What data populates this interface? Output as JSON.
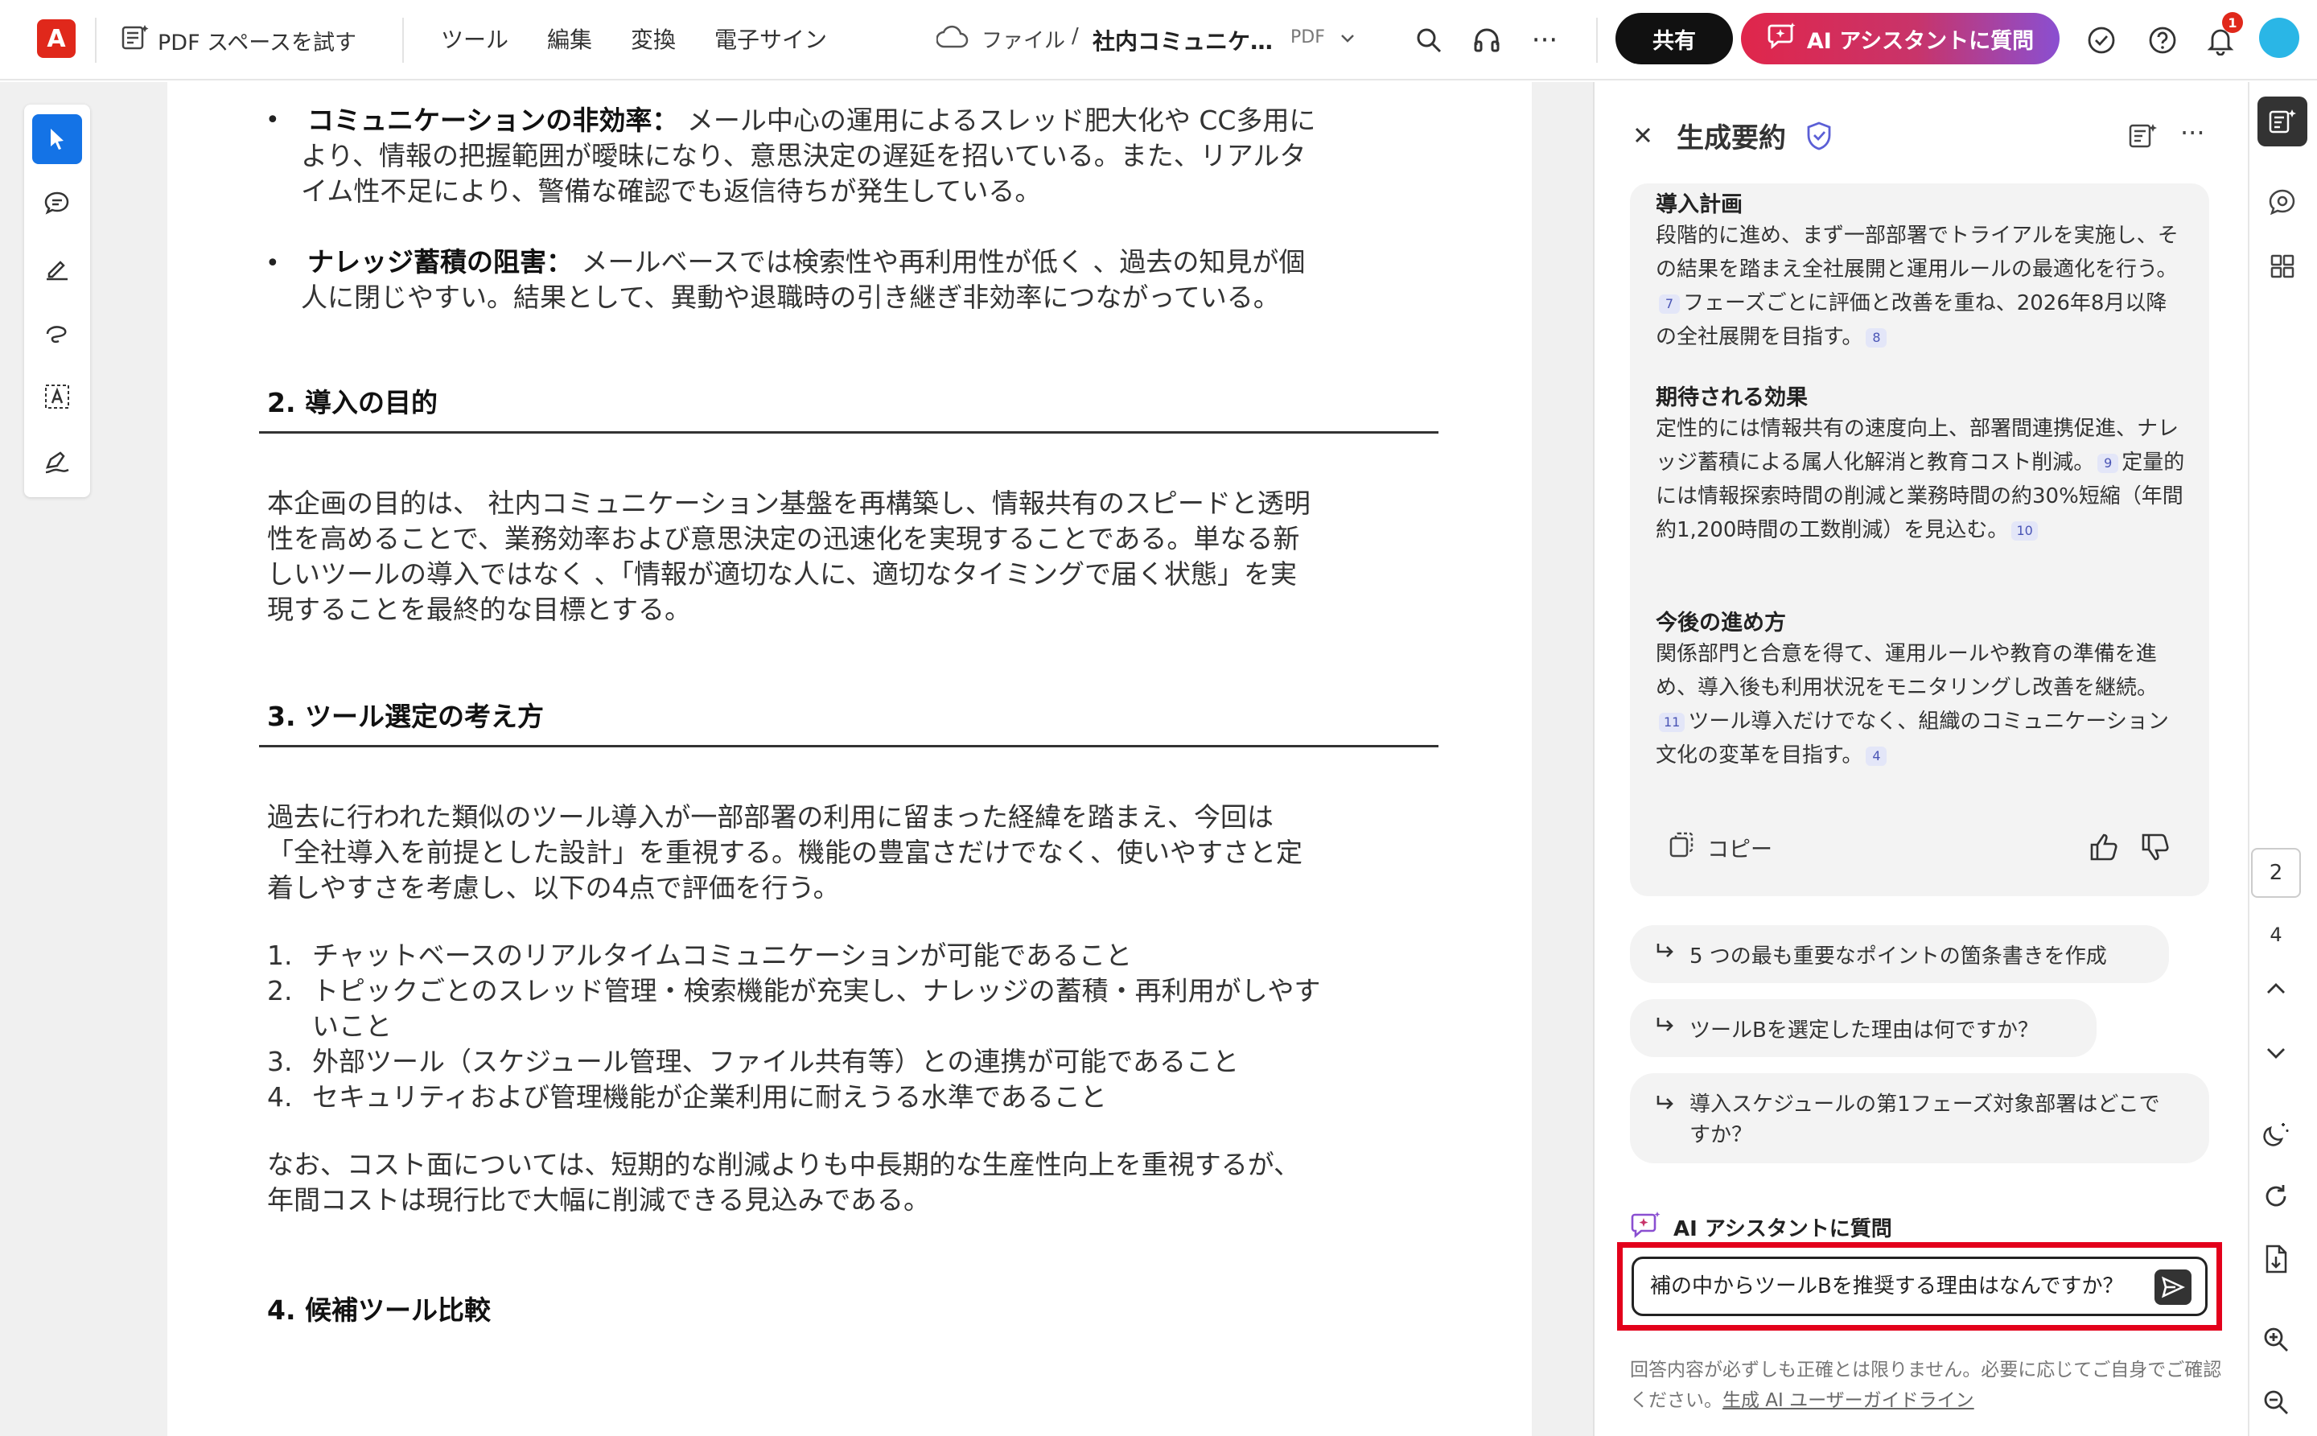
{
  "topbar": {
    "logo_glyph": "A",
    "try_pdf_space": "PDF スペースを試す",
    "menus": [
      "ツール",
      "編集",
      "変換",
      "電子サイン"
    ],
    "breadcrumb_files": "ファイル",
    "breadcrumb_sep": "/",
    "file_name": "社内コミュニケ…",
    "file_type": "PDF",
    "share": "共有",
    "ai_assistant": "AI アシスタントに質問",
    "notification_count": "1",
    "more": "···"
  },
  "document": {
    "bullets": [
      {
        "title": "コミュニケーションの非効率：",
        "lines": [
          "メール中心の運用によるスレッド肥大化や CC多用に",
          "より、情報の把握範囲が曖昧になり、意思決定の遅延を招いている。また、リアルタ",
          "イム性不足により、警備な確認でも返信待ちが発生している。"
        ]
      },
      {
        "title": "ナレッジ蓄積の阻害：",
        "lines": [
          "メールベースでは検索性や再利用性が低く 、過去の知見が個",
          "人に閉じやすい。結果として、異動や退職時の引き継ぎ非効率につながっている。"
        ]
      }
    ],
    "section2": {
      "heading": "2. 導入の目的",
      "paragraph": [
        "本企画の目的は、 社内コミュニケーション基盤を再構築し、情報共有のスピードと透明",
        "性を高めることで、業務効率および意思決定の迅速化を実現することである。単なる新",
        "しいツールの導入ではなく 、「情報が適切な人に、適切なタイミングで届く状態」を実",
        "現することを最終的な目標とする。"
      ]
    },
    "section3": {
      "heading": "3. ツール選定の考え方",
      "paragraph": [
        "過去に行われた類似のツール導入が一部部署の利用に留まった経緯を踏まえ、今回は",
        "「全社導入を前提とした設計」を重視する。機能の豊富さだけでなく、使いやすさと定",
        "着しやすさを考慮し、以下の4点で評価を行う。"
      ],
      "list": [
        {
          "num": "1.",
          "lines": [
            "チャットベースのリアルタイムコミュニケーションが可能であること"
          ]
        },
        {
          "num": "2.",
          "lines": [
            "トピックごとのスレッド管理・検索機能が充実し、ナレッジの蓄積・再利用がしやす",
            "いこと"
          ]
        },
        {
          "num": "3.",
          "lines": [
            "外部ツール（スケジュール管理、ファイル共有等）との連携が可能であること"
          ]
        },
        {
          "num": "4.",
          "lines": [
            "セキュリティおよび管理機能が企業利用に耐えうる水準であること"
          ]
        }
      ],
      "closing": [
        "なお、コスト面については、短期的な削減よりも中長期的な生産性向上を重視するが、",
        "年間コストは現行比で大幅に削減できる見込みである。"
      ]
    },
    "section4": {
      "heading": "4. 候補ツール比較"
    }
  },
  "ai_panel": {
    "title": "生成要約",
    "sections": [
      {
        "heading": "導入計画",
        "segments": [
          {
            "text": "段階的に進め、まず一部部署でトライアルを実施し、その結果を踏まえ全社展開と運用ルールの最適化を行う。"
          },
          {
            "cite": "7"
          },
          {
            "text": "フェーズごとに評価と改善を重ね、2026年8月以降の全社展開を目指す。"
          },
          {
            "cite": "8"
          }
        ]
      },
      {
        "heading": "期待される効果",
        "segments": [
          {
            "text": "定性的には情報共有の速度向上、部署間連携促進、ナレッジ蓄積による属人化解消と教育コスト削減。"
          },
          {
            "cite": "9"
          },
          {
            "text": "定量的には情報探索時間の削減と業務時間の約30%短縮（年間約1,200時間の工数削減）を見込む。"
          },
          {
            "cite": "10"
          }
        ]
      },
      {
        "heading": "今後の進め方",
        "segments": [
          {
            "text": "関係部門と合意を得て、運用ルールや教育の準備を進め、導入後も利用状況をモニタリングし改善を継続。"
          },
          {
            "cite": "11"
          },
          {
            "text": "ツール導入だけでなく、組織のコミュニケーション文化の変革を目指す。"
          },
          {
            "cite": "4"
          }
        ]
      }
    ],
    "copy_label": "コピー",
    "suggestions": [
      "5 つの最も重要なポイントの箇条書きを作成",
      "ツールBを選定した理由は何ですか？",
      "導入スケジュールの第1フェーズ対象部署はどこですか？"
    ],
    "ask_label": "AI アシスタントに質問",
    "ask_value": "補の中からツールBを推奨する理由はなんですか？",
    "disclaimer_text": "回答内容が必ずしも正確とは限りません。必要に応じてご自身でご確認ください。",
    "disclaimer_link": "生成 AI ユーザーガイドライン"
  },
  "right_rail": {
    "current_page": "2",
    "total_pages": "4"
  },
  "colors": {
    "accent_blue": "#1473e6",
    "acrobat_red": "#e0281b",
    "highlight_red": "#e3001b"
  }
}
